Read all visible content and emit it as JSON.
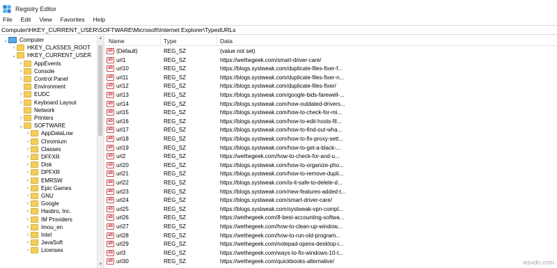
{
  "window": {
    "title": "Registry Editor"
  },
  "menu": [
    "File",
    "Edit",
    "View",
    "Favorites",
    "Help"
  ],
  "address": "Computer\\HKEY_CURRENT_USER\\SOFTWARE\\Microsoft\\Internet Explorer\\TypedURLs",
  "tree": [
    {
      "label": "Computer",
      "indent": 0,
      "chevron": "⌄",
      "icon": "computer-icon"
    },
    {
      "label": "HKEY_CLASSES_ROOT",
      "indent": 1,
      "chevron": "›",
      "icon": "folder-icon"
    },
    {
      "label": "HKEY_CURRENT_USER",
      "indent": 1,
      "chevron": "⌄",
      "icon": "folder-icon"
    },
    {
      "label": "AppEvents",
      "indent": 2,
      "chevron": "›",
      "icon": "folder-icon"
    },
    {
      "label": "Console",
      "indent": 2,
      "chevron": "›",
      "icon": "folder-icon"
    },
    {
      "label": "Control Panel",
      "indent": 2,
      "chevron": "›",
      "icon": "folder-icon"
    },
    {
      "label": "Environment",
      "indent": 2,
      "chevron": "",
      "icon": "folder-icon"
    },
    {
      "label": "EUDC",
      "indent": 2,
      "chevron": "›",
      "icon": "folder-icon"
    },
    {
      "label": "Keyboard Layout",
      "indent": 2,
      "chevron": "›",
      "icon": "folder-icon"
    },
    {
      "label": "Network",
      "indent": 2,
      "chevron": "",
      "icon": "folder-icon"
    },
    {
      "label": "Printers",
      "indent": 2,
      "chevron": "›",
      "icon": "folder-icon"
    },
    {
      "label": "SOFTWARE",
      "indent": 2,
      "chevron": "⌄",
      "icon": "folder-icon"
    },
    {
      "label": "AppDataLow",
      "indent": 3,
      "chevron": "›",
      "icon": "folder-icon"
    },
    {
      "label": "Chromium",
      "indent": 3,
      "chevron": "›",
      "icon": "folder-icon"
    },
    {
      "label": "Classes",
      "indent": 3,
      "chevron": "›",
      "icon": "folder-icon"
    },
    {
      "label": "DFFXR",
      "indent": 3,
      "chevron": "›",
      "icon": "folder-icon"
    },
    {
      "label": "Disk",
      "indent": 3,
      "chevron": "›",
      "icon": "folder-icon"
    },
    {
      "label": "DPFXR",
      "indent": 3,
      "chevron": "›",
      "icon": "folder-icon"
    },
    {
      "label": "EMRSW",
      "indent": 3,
      "chevron": "›",
      "icon": "folder-icon"
    },
    {
      "label": "Epic Games",
      "indent": 3,
      "chevron": "›",
      "icon": "folder-icon"
    },
    {
      "label": "GNU",
      "indent": 3,
      "chevron": "›",
      "icon": "folder-icon"
    },
    {
      "label": "Google",
      "indent": 3,
      "chevron": "›",
      "icon": "folder-icon"
    },
    {
      "label": "Hasbro, Inc.",
      "indent": 3,
      "chevron": "›",
      "icon": "folder-icon"
    },
    {
      "label": "IM Providers",
      "indent": 3,
      "chevron": "›",
      "icon": "folder-icon"
    },
    {
      "label": "Imou_en",
      "indent": 3,
      "chevron": "›",
      "icon": "folder-icon"
    },
    {
      "label": "Intel",
      "indent": 3,
      "chevron": "›",
      "icon": "folder-icon"
    },
    {
      "label": "JavaSoft",
      "indent": 3,
      "chevron": "›",
      "icon": "folder-icon"
    },
    {
      "label": "Licenses",
      "indent": 3,
      "chevron": "›",
      "icon": "folder-icon"
    }
  ],
  "columns": {
    "name": "Name",
    "type": "Type",
    "data": "Data"
  },
  "values": [
    {
      "name": "(Default)",
      "type": "REG_SZ",
      "data": "(value not set)"
    },
    {
      "name": "url1",
      "type": "REG_SZ",
      "data": "https://wethegeek.com/smart-driver-care/"
    },
    {
      "name": "url10",
      "type": "REG_SZ",
      "data": "https://blogs.systweak.com/duplicate-files-fixer-f..."
    },
    {
      "name": "url11",
      "type": "REG_SZ",
      "data": "https://blogs.systweak.com/duplicate-files-fixer-n..."
    },
    {
      "name": "url12",
      "type": "REG_SZ",
      "data": "https://blogs.systweak.com/duplicate-files-fixer/"
    },
    {
      "name": "url13",
      "type": "REG_SZ",
      "data": "https://blogs.systweak.com/google-bids-farewell-..."
    },
    {
      "name": "url14",
      "type": "REG_SZ",
      "data": "https://blogs.systweak.com/how-outdated-drivers..."
    },
    {
      "name": "url15",
      "type": "REG_SZ",
      "data": "https://blogs.systweak.com/how-to-check-for-mi..."
    },
    {
      "name": "url16",
      "type": "REG_SZ",
      "data": "https://blogs.systweak.com/how-to-edit-hosts-fil..."
    },
    {
      "name": "url17",
      "type": "REG_SZ",
      "data": "https://blogs.systweak.com/how-to-find-out-wha..."
    },
    {
      "name": "url18",
      "type": "REG_SZ",
      "data": "https://blogs.systweak.com/how-to-fix-proxy-sett..."
    },
    {
      "name": "url19",
      "type": "REG_SZ",
      "data": "https://blogs.systweak.com/how-to-get-a-black-..."
    },
    {
      "name": "url2",
      "type": "REG_SZ",
      "data": "https://wethegeek.com/how-to-check-for-and-u..."
    },
    {
      "name": "url20",
      "type": "REG_SZ",
      "data": "https://blogs.systweak.com/how-to-organize-pho..."
    },
    {
      "name": "url21",
      "type": "REG_SZ",
      "data": "https://blogs.systweak.com/how-to-remove-dupli..."
    },
    {
      "name": "url22",
      "type": "REG_SZ",
      "data": "https://blogs.systweak.com/is-it-safe-to-delete-d..."
    },
    {
      "name": "url23",
      "type": "REG_SZ",
      "data": "https://blogs.systweak.com/new-features-added-t..."
    },
    {
      "name": "url24",
      "type": "REG_SZ",
      "data": "https://blogs.systweak.com/smart-driver-care/"
    },
    {
      "name": "url25",
      "type": "REG_SZ",
      "data": "https://blogs.systweak.com/systweak-vpn-compl..."
    },
    {
      "name": "url26",
      "type": "REG_SZ",
      "data": "https://wethegeek.com/8-best-accounting-softwa..."
    },
    {
      "name": "url27",
      "type": "REG_SZ",
      "data": "https://wethegeek.com/how-to-clean-up-window..."
    },
    {
      "name": "url28",
      "type": "REG_SZ",
      "data": "https://wethegeek.com/how-to-run-old-program..."
    },
    {
      "name": "url29",
      "type": "REG_SZ",
      "data": "https://wethegeek.com/notepad-opens-desktop-i..."
    },
    {
      "name": "url3",
      "type": "REG_SZ",
      "data": "https://wethegeek.com/ways-to-fix-windows-10-t..."
    },
    {
      "name": "url30",
      "type": "REG_SZ",
      "data": "https://wethegeek.com/quickbooks-alternative/"
    }
  ],
  "watermark": "wsxdn.com",
  "colors": {
    "folder": "#f3cf5a",
    "string_icon": "#c42b2b",
    "computer": "#58a8e4"
  }
}
